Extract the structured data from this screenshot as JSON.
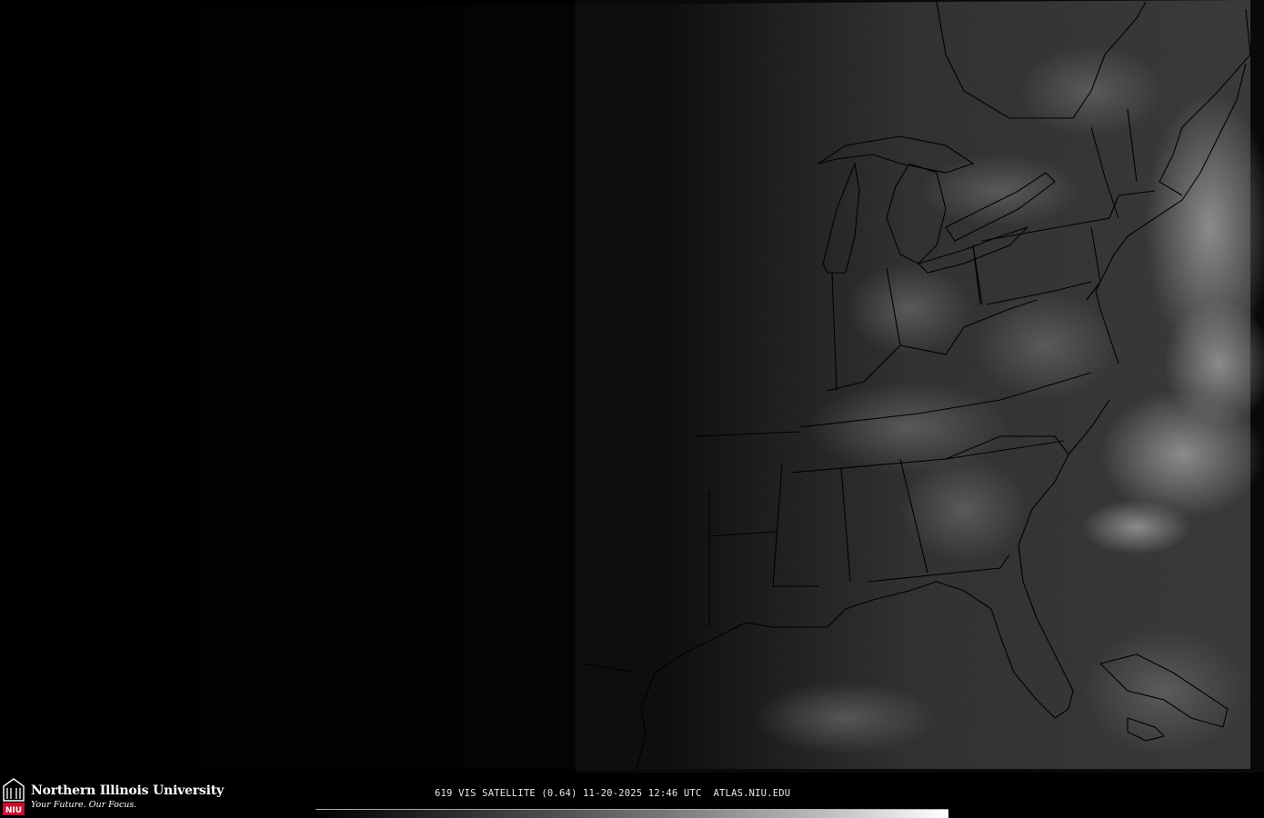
{
  "map": {
    "type": "visible satellite imagery",
    "region": "eastern United States",
    "image_bg": "#000000",
    "boundary_color": "#000000"
  },
  "branding": {
    "university_name": "Northern Illinois University",
    "tagline": "Your Future. Our Focus.",
    "logo_letters": "NIU",
    "logo_color": "#c8102e"
  },
  "caption": {
    "text": "619 VIS SATELLITE (0.64) 11-20-2025 12:46 UTC  ATLAS.NIU.EDU"
  },
  "colorbar": {
    "min_color": "#000000",
    "max_color": "#ffffff"
  }
}
